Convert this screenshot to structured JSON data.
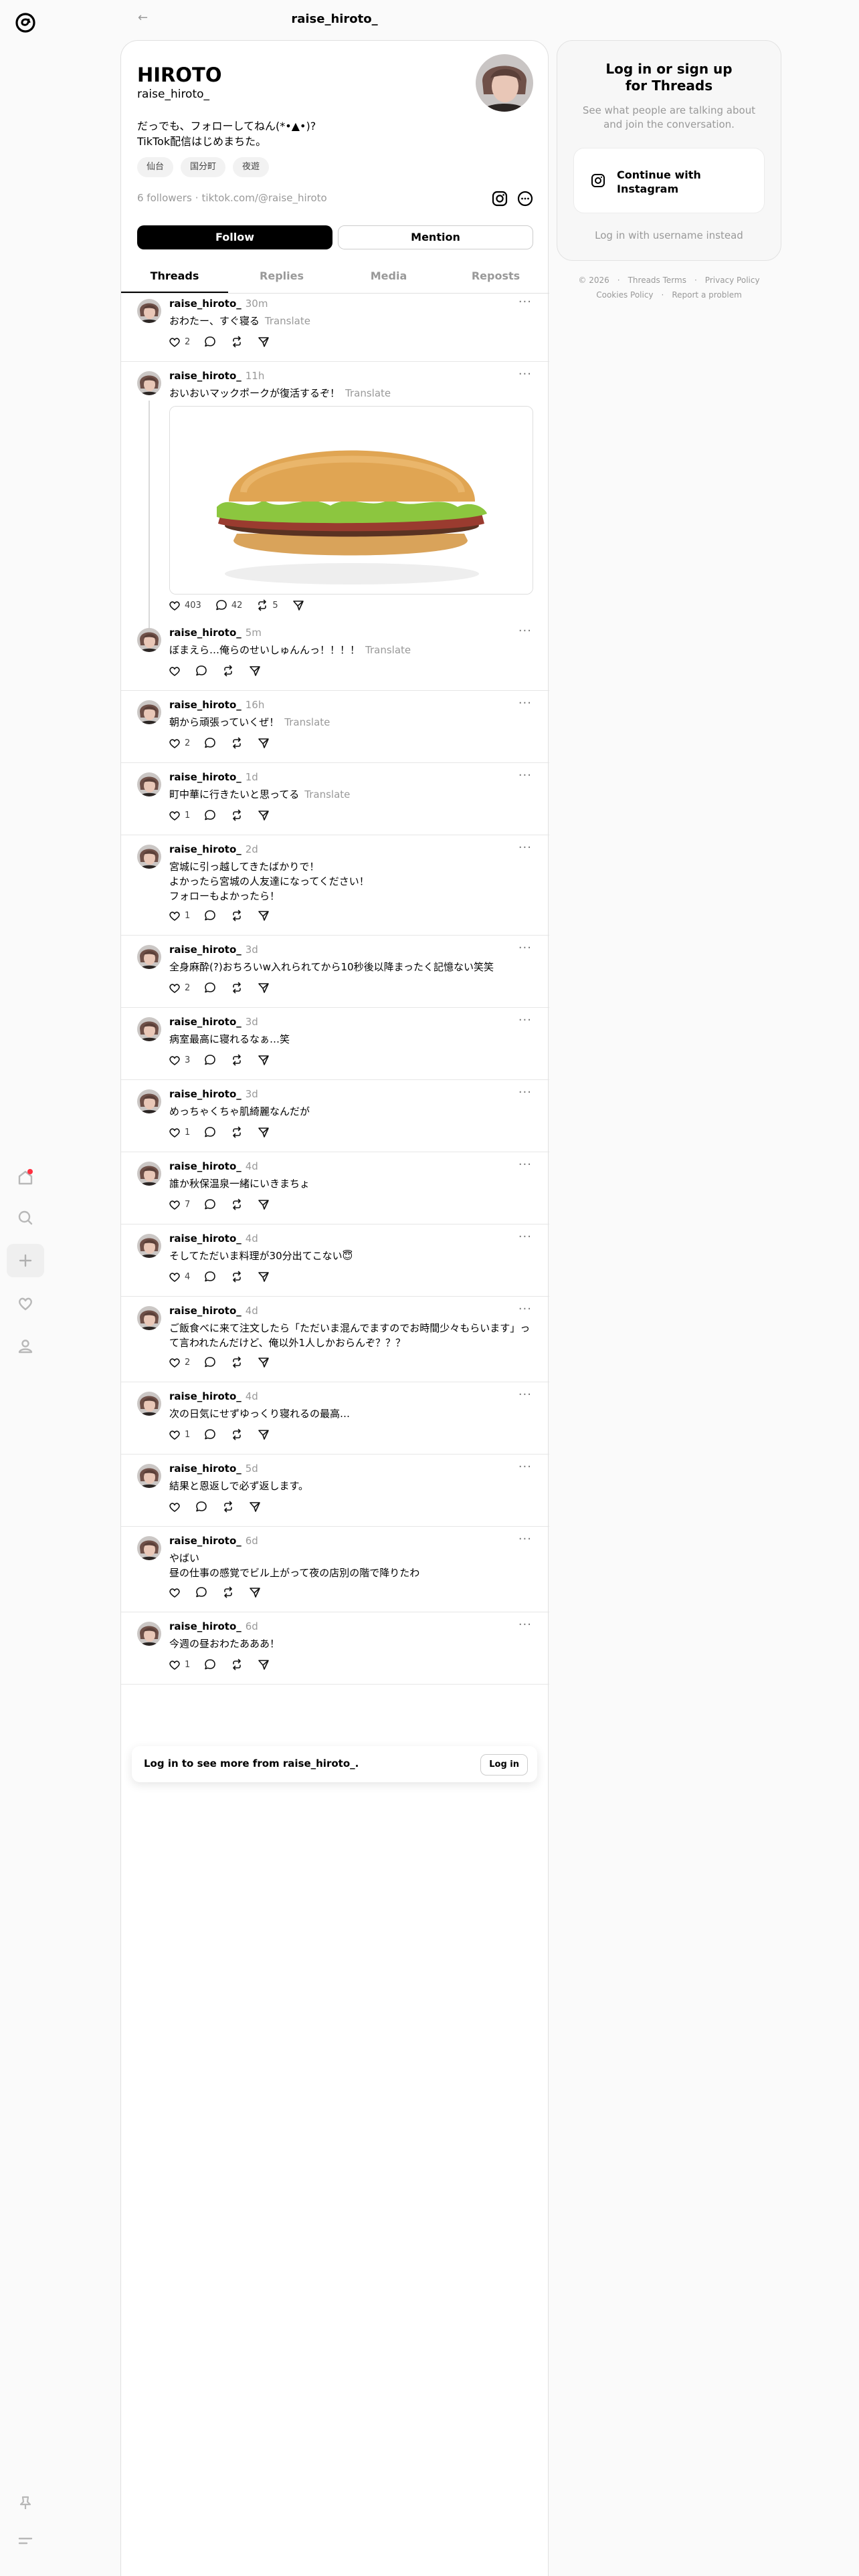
{
  "header": {
    "title": "raise_hiroto_",
    "back_label": "←"
  },
  "profile": {
    "name": "HIROTO",
    "handle": "raise_hiroto_",
    "bio": "だっでも、フォローしてねん(*•▲•)?\nTikTok配信はじめまちた。",
    "tags": [
      "仙台",
      "国分町",
      "夜遊"
    ],
    "followers": "6 followers",
    "link": "tiktok.com/@raise_hiroto",
    "follow_label": "Follow",
    "mention_label": "Mention"
  },
  "tabs": [
    "Threads",
    "Replies",
    "Media",
    "Reposts"
  ],
  "posts": [
    {
      "user": "raise_hiroto_",
      "time": "30m",
      "text": "おわたー、すぐ寝る",
      "translate": "Translate",
      "likes": "2",
      "replies": "",
      "reposts": ""
    },
    {
      "user": "raise_hiroto_",
      "time": "11h",
      "text": "おいおいマックポークが復活するぞ！",
      "translate": "Translate",
      "likes": "403",
      "replies": "42",
      "reposts": "5"
    },
    {
      "user": "raise_hiroto_",
      "time": "5m",
      "text": "ぼまえら…俺らのせいしゅんんっ！！！！",
      "translate": "Translate",
      "likes": "",
      "replies": "",
      "reposts": ""
    },
    {
      "user": "raise_hiroto_",
      "time": "16h",
      "text": "朝から頑張っていくぜ！",
      "translate": "Translate",
      "likes": "2",
      "replies": "",
      "reposts": ""
    },
    {
      "user": "raise_hiroto_",
      "time": "1d",
      "text": "町中華に行きたいと思ってる",
      "translate": "Translate",
      "likes": "1",
      "replies": "",
      "reposts": ""
    },
    {
      "user": "raise_hiroto_",
      "time": "2d",
      "text": "宮城に引っ越してきたばかりで！\nよかったら宮城の人友達になってください！\nフォローもよかったら！",
      "translate": "",
      "likes": "1",
      "replies": "",
      "reposts": ""
    },
    {
      "user": "raise_hiroto_",
      "time": "3d",
      "text": "全身麻酔(?)おちろいw入れられてから10秒後以降まったく記憶ない笑笑",
      "translate": "",
      "likes": "2",
      "replies": "",
      "reposts": ""
    },
    {
      "user": "raise_hiroto_",
      "time": "3d",
      "text": "病室最高に寝れるなぁ…笑",
      "translate": "",
      "likes": "3",
      "replies": "",
      "reposts": ""
    },
    {
      "user": "raise_hiroto_",
      "time": "3d",
      "text": "めっちゃくちゃ肌綺麗なんだが",
      "translate": "",
      "likes": "1",
      "replies": "",
      "reposts": ""
    },
    {
      "user": "raise_hiroto_",
      "time": "4d",
      "text": "誰か秋保温泉一緒にいきまちょ",
      "translate": "",
      "likes": "7",
      "replies": "",
      "reposts": ""
    },
    {
      "user": "raise_hiroto_",
      "time": "4d",
      "text": "そしてただいま料理が30分出てこない😇",
      "translate": "",
      "likes": "4",
      "replies": "",
      "reposts": ""
    },
    {
      "user": "raise_hiroto_",
      "time": "4d",
      "text": "ご飯食べに来て注文したら「ただいま混んでますのでお時間少々もらいます」って言われたんだけど、俺以外1人しかおらんぞ？？？",
      "translate": "",
      "likes": "2",
      "replies": "",
      "reposts": ""
    },
    {
      "user": "raise_hiroto_",
      "time": "4d",
      "text": "次の日気にせずゆっくり寝れるの最高…",
      "translate": "",
      "likes": "1",
      "replies": "",
      "reposts": ""
    },
    {
      "user": "raise_hiroto_",
      "time": "5d",
      "text": "結果と恩返しで必ず返します。",
      "translate": "",
      "likes": "",
      "replies": "",
      "reposts": ""
    },
    {
      "user": "raise_hiroto_",
      "time": "6d",
      "text": "やばい\n昼の仕事の感覚でビル上がって夜の店別の階で降りたわ",
      "translate": "",
      "likes": "",
      "replies": "",
      "reposts": ""
    },
    {
      "user": "raise_hiroto_",
      "time": "6d",
      "text": "今週の昼おわたあああ！",
      "translate": "",
      "likes": "1",
      "replies": "",
      "reposts": ""
    }
  ],
  "more_menu": "···",
  "login_prompt": {
    "text": "Log in to see more from raise_hiroto_.",
    "button": "Log in"
  },
  "sidebar": {
    "title": "Log in or sign up\nfor Threads",
    "subtitle": "See what people are talking about and join the conversation.",
    "continue_label": "Continue with\nInstagram",
    "username_login": "Log in with username instead"
  },
  "footer": {
    "year": "© 2026",
    "links": [
      "Threads Terms",
      "Privacy Policy",
      "Cookies Policy",
      "Report a problem"
    ]
  },
  "colors": {
    "accent": "#000000",
    "notify": "#ff3040",
    "muted": "#999999"
  },
  "icons": [
    "threads-logo-icon",
    "home-icon",
    "search-icon",
    "plus-icon",
    "heart-icon",
    "profile-icon",
    "pin-icon",
    "menu-icon",
    "instagram-icon",
    "more-circle-icon",
    "comment-icon",
    "repost-icon",
    "share-icon"
  ]
}
